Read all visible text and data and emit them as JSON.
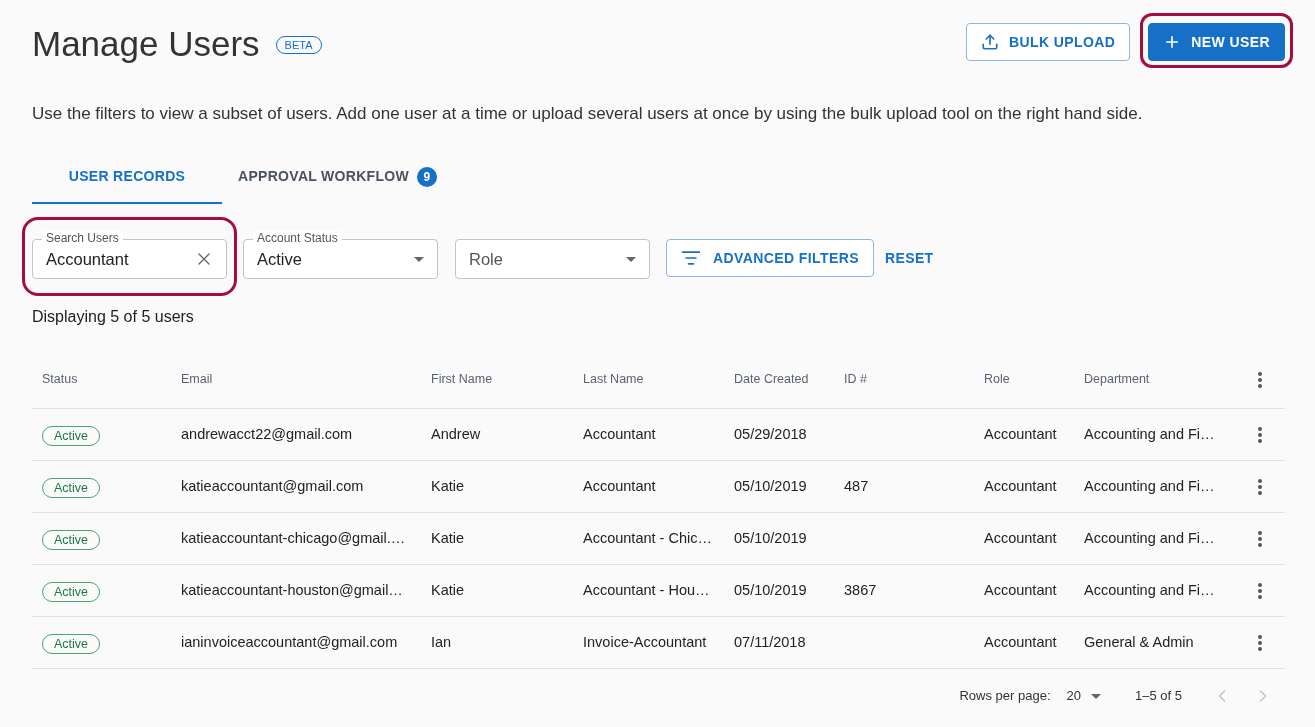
{
  "header": {
    "title": "Manage Users",
    "badge": "BETA",
    "buttons": [
      {
        "kind": "upload",
        "label": "BULK UPLOAD",
        "highlighted": false
      },
      {
        "kind": "add",
        "label": "NEW USER",
        "highlighted": true
      }
    ]
  },
  "description": "Use the filters to view a subset of users. Add one user at a time or upload several users at once by using the bulk upload tool on the right hand side.",
  "tabs": [
    {
      "label": "USER RECORDS",
      "selected": true
    },
    {
      "label": "APPROVAL WORKFLOW",
      "selected": false,
      "badge": "9"
    }
  ],
  "filters": {
    "search": {
      "label": "Search Users",
      "value": "Accountant",
      "highlighted": true
    },
    "selects": [
      {
        "label": "Account Status",
        "value": "Active"
      },
      {
        "placeholder": "Role"
      }
    ],
    "advanced_button": "ADVANCED FILTERS",
    "reset_button": "RESET"
  },
  "result_count": "Displaying 5 of 5 users",
  "table": {
    "columns": [
      "Status",
      "Email",
      "First Name",
      "Last Name",
      "Date Created",
      "ID #",
      "Role",
      "Department"
    ],
    "rows": [
      {
        "status": "Active",
        "email": "andrewacct22@gmail.com",
        "first_name": "Andrew",
        "last_name": "Accountant",
        "date_created": "05/29/2018",
        "role": "Accountant",
        "department": "Accounting and Fi…"
      },
      {
        "status": "Active",
        "email": "katieaccountant@gmail.com",
        "first_name": "Katie",
        "last_name": "Accountant",
        "date_created": "05/10/2019",
        "id_number": "487",
        "role": "Accountant",
        "department": "Accounting and Fi…"
      },
      {
        "status": "Active",
        "email": "katieaccountant-chicago@gmail.…",
        "first_name": "Katie",
        "last_name": "Accountant - Chic…",
        "date_created": "05/10/2019",
        "role": "Accountant",
        "department": "Accounting and Fi…"
      },
      {
        "status": "Active",
        "email": "katieaccountant-houston@gmail…",
        "first_name": "Katie",
        "last_name": "Accountant - Hou…",
        "date_created": "05/10/2019",
        "id_number": "3867",
        "role": "Accountant",
        "department": "Accounting and Fi…"
      },
      {
        "status": "Active",
        "email": "ianinvoiceaccountant@gmail.com",
        "first_name": "Ian",
        "last_name": "Invoice-Accountant",
        "date_created": "07/11/2018",
        "role": "Accountant",
        "department": "General & Admin"
      }
    ]
  },
  "pagination": {
    "rows_per_page_label": "Rows per page:",
    "rows_per_page": "20",
    "range": "1–5 of 5",
    "prev_disabled": true,
    "next_disabled": true
  }
}
